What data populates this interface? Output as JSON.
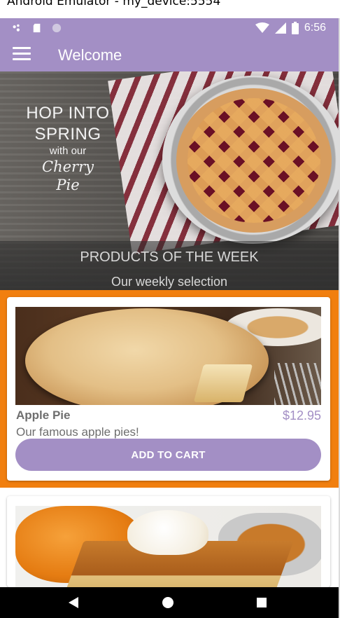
{
  "window": {
    "title": "Android Emulator - my_device:5554"
  },
  "status_bar": {
    "time": "6:56",
    "icons": [
      "notification-dots-icon",
      "sd-card-icon",
      "sync-circle-icon",
      "wifi-icon",
      "cell-signal-icon",
      "battery-icon"
    ]
  },
  "app_bar": {
    "menu_icon": "hamburger-menu-icon",
    "title": "Welcome"
  },
  "hero": {
    "line1": "HOP INTO",
    "line2": "SPRING",
    "line3": "with our",
    "line4": "Cherry",
    "line5": "Pie",
    "products_title": "PRODUCTS OF THE WEEK",
    "products_subtitle": "Our weekly selection"
  },
  "products": [
    {
      "name": "Apple Pie",
      "price": "$12.95",
      "description": "Our famous apple pies!",
      "button": "ADD TO CART",
      "highlighted": true
    },
    {
      "name": "",
      "price": "",
      "description": "",
      "button": "",
      "highlighted": false
    }
  ],
  "nav_bar": {
    "icons": [
      "back-icon",
      "home-icon",
      "recents-icon"
    ]
  },
  "colors": {
    "primary": "#a38fc5",
    "highlight": "#f17f0f",
    "text_gray": "#6e6e6e"
  }
}
